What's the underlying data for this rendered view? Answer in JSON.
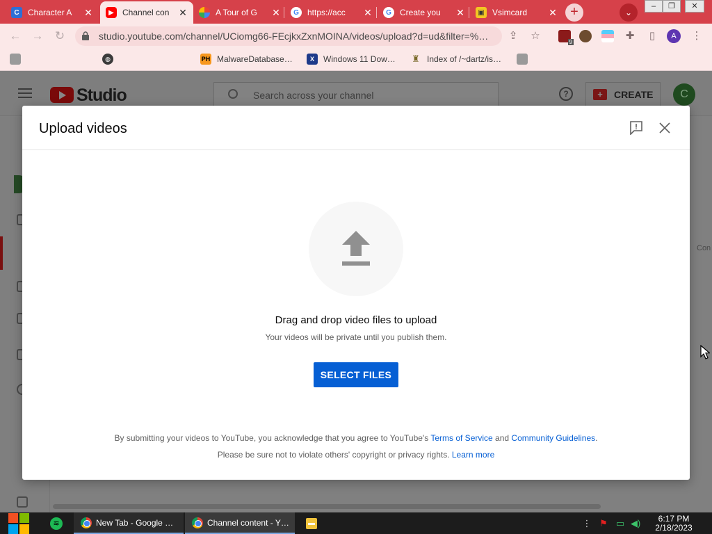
{
  "browser": {
    "tabs": [
      {
        "title": "Character A",
        "favicon": "character-ai-icon",
        "active": false
      },
      {
        "title": "Channel con",
        "favicon": "youtube-icon",
        "active": true
      },
      {
        "title": "A Tour of G",
        "favicon": "gcp-icon",
        "active": false
      },
      {
        "title": "https://acc",
        "favicon": "google-icon",
        "active": false
      },
      {
        "title": "Create you",
        "favicon": "google-icon",
        "active": false
      },
      {
        "title": "Vsimcard",
        "favicon": "sim-card-icon",
        "active": false
      }
    ],
    "new_tab_symbol": "+",
    "url": "studio.youtube.com/channel/UCiomg66-FEcjkxZxnMOINA/videos/upload?d=ud&filter=%…",
    "profile_initial": "A",
    "extension_badge": "9",
    "bookmarks": [
      {
        "label": "",
        "icon": "bookmark-icon"
      },
      {
        "label": "",
        "icon": "globe-icon"
      },
      {
        "label": "MalwareDatabase…",
        "icon": "ph-icon"
      },
      {
        "label": "Windows 11 Dow…",
        "icon": "x-icon"
      },
      {
        "label": "Index of /~dartz/is…",
        "icon": "tower-icon"
      },
      {
        "label": "",
        "icon": "bookmark-icon"
      }
    ]
  },
  "studio": {
    "logo_text": "Studio",
    "search_placeholder": "Search across your channel",
    "create_label": "CREATE",
    "channel_initial": "C",
    "partial_text": "Con"
  },
  "dialog": {
    "title": "Upload videos",
    "drop_title": "Drag and drop video files to upload",
    "drop_subtitle": "Your videos will be private until you publish them.",
    "select_button": "SELECT FILES",
    "legal_line1_prefix": "By submitting your videos to YouTube, you acknowledge that you agree to YouTube's ",
    "terms_link": "Terms of Service",
    "legal_and": " and ",
    "guidelines_link": "Community Guidelines",
    "legal_line1_suffix": ".",
    "legal_line2_prefix": "Please be sure not to violate others' copyright or privacy rights. ",
    "learn_more_link": "Learn more"
  },
  "taskbar": {
    "apps": [
      {
        "label": "New Tab - Google …",
        "active": false
      },
      {
        "label": "Channel content - Y…",
        "active": true
      }
    ],
    "time": "6:17 PM",
    "date": "2/18/2023"
  },
  "colors": {
    "tabstrip": "#d6414a",
    "accent_blue": "#065fd4",
    "youtube_red": "#ff0000"
  }
}
